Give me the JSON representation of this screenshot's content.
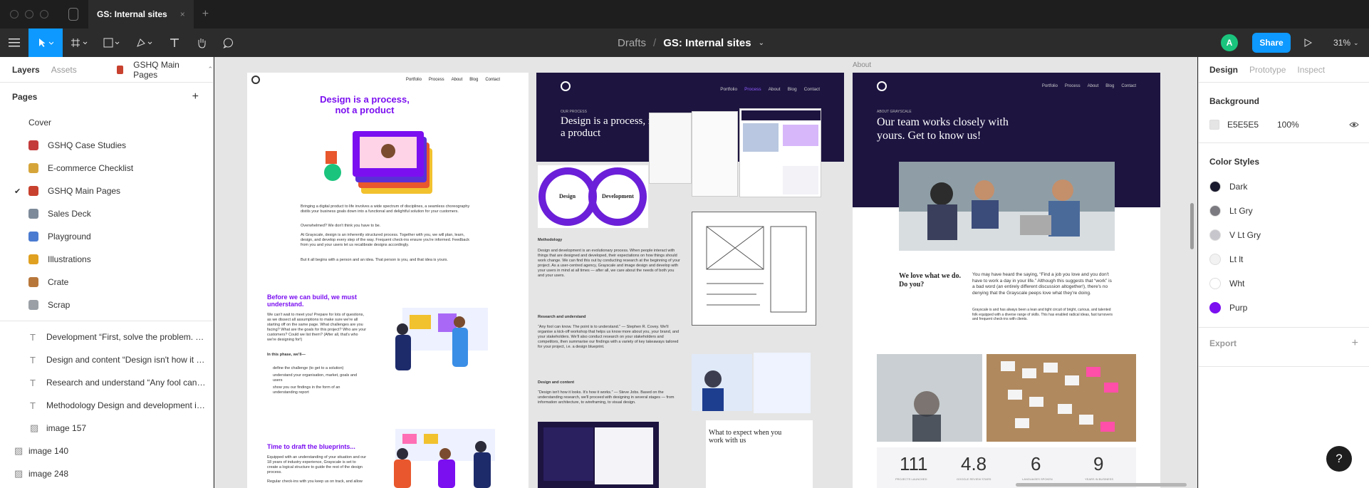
{
  "titlebar": {
    "tab_title": "GS: Internal sites",
    "tab_close": "×",
    "new_tab": "+"
  },
  "toolbar": {
    "breadcrumb_drafts": "Drafts",
    "breadcrumb_sep": "/",
    "breadcrumb_file": "GS: Internal sites",
    "avatar_initial": "A",
    "share_label": "Share",
    "zoom": "31%"
  },
  "left_panel": {
    "tabs": [
      "Layers",
      "Assets"
    ],
    "current_page": "GSHQ Main Pages",
    "pages_header": "Pages",
    "add": "+",
    "pages": [
      {
        "label": "Cover",
        "color": ""
      },
      {
        "label": "GSHQ Case Studies",
        "color": "#c43b3b"
      },
      {
        "label": "E-commerce Checklist",
        "color": "#d6a53a"
      },
      {
        "label": "GSHQ Main Pages",
        "color": "#c8412e",
        "checked": true
      },
      {
        "label": "Sales Deck",
        "color": "#7d8a99"
      },
      {
        "label": "Playground",
        "color": "#4a7bd0"
      },
      {
        "label": "Illustrations",
        "color": "#e0a020"
      },
      {
        "label": "Crate",
        "color": "#b8773a"
      },
      {
        "label": "Scrap",
        "color": "#9aa0a6"
      }
    ],
    "layers": [
      {
        "label": "Development “First, solve the problem. T...",
        "icon": "text-icon"
      },
      {
        "label": "Design and content “Design isn't how it lo...",
        "icon": "text-icon"
      },
      {
        "label": "Research and understand “Any fool can k...",
        "icon": "text-icon"
      },
      {
        "label": "Methodology Design and development is...",
        "icon": "text-icon"
      },
      {
        "label": "image 157",
        "icon": "image-icon"
      },
      {
        "label": "image 140",
        "icon": "image-icon"
      },
      {
        "label": "image 248",
        "icon": "image-icon"
      }
    ]
  },
  "canvas": {
    "frame_label": "About",
    "board1": {
      "nav": [
        "Portfolio",
        "Process",
        "About",
        "Blog",
        "Contact"
      ],
      "headline": "Design is a process, not a product",
      "intro": "Bringing a digital product to life involves a wide spectrum of disciplines, a seamless choreography distils your business goals down into a functional and delightful solution for your customers.",
      "intro2": "Overwhelmed? We don't think you have to be.",
      "intro3": "At Grayscale, design is an inherently structured process. Together with you, we will plan, learn, design, and develop every step of the way. Frequent check-ins ensure you're informed. Feedback from you and your users let us recalibrate designs accordingly.",
      "intro4": "But it all begins with a person and an idea. That person is you, and that idea is yours.",
      "h2": "Before we can build, we must understand.",
      "body2": "We can't wait to meet you! Prepare for lots of questions, as we dissect all assumptions to make sure we're all starting off on the same page. What challenges are you facing? What are the goals for this project? Who are your customers? Could we list them? (After all, that's who we're designing for!)",
      "phase": "In this phase, we'll—",
      "bullets": [
        "define the challenge (to get to a solution)",
        "understand your organisation, market, goals and users",
        "show you our findings in the form of an understanding report"
      ],
      "h3": "Time to draft the blueprints...",
      "body3": "Equipped with an understanding of your situation and our 18 years of industry experience, Grayscale is set to create a logical structure to guide the rest of the design process.",
      "body3b": "Regular check-ins with you keep us on track, and allow"
    },
    "board2": {
      "eyebrow": "OUR PROCESS",
      "headline": "Design is a process, not a product",
      "nav": [
        "Portfolio",
        "Process",
        "About",
        "Blog",
        "Contact"
      ],
      "ring1": "Design",
      "ring2": "Development",
      "methodology": "Methodology",
      "meth_body": "Design and development is an evolutionary process. When people interact with things that are designed and developed, their expectations on how things should work change. We can find this out by conducting research at the beginning of your project. As a user-centred agency, Grayscale and image design and develop with your users in mind at all times — after all, we care about the needs of both you and your users.",
      "research": "Research and understand",
      "research_body": "“Any fool can know. The point is to understand.” — Stephen R. Covey. We'll organise a kick-off workshop that helps us know more about you, your brand, and your stakeholders. We'll also conduct research on your stakeholders and competitors, then summarise our findings with a variety of key takeaways tailored for your project, i.e. a design blueprint.",
      "design": "Design and content",
      "design_body": "“Design isn't how it looks. It's how it works.” — Steve Jobs. Based on the understanding research, we'll proceed with designing in several stages — from information architecture, to wireframing, to visual design.",
      "expect": "What to expect when you work with us"
    },
    "board3": {
      "eyebrow": "ABOUT GRAYSCALE",
      "headline": "Our team works closely with yours. Get to know us!",
      "nav": [
        "Portfolio",
        "Process",
        "About",
        "Blog",
        "Contact"
      ],
      "love": "We love what we do. Do you?",
      "love_body": "You may have heard the saying, “Find a job you love and you don't have to work a day in your life.” Although this suggests that “work” is a bad word (an entirely different discussion altogether!), there's no denying that the Grayscale peeps love what they're doing.",
      "love_body2": "Grayscale is and has always been a lean and tight circuit of bright, curious, and talented folk equipped with a diverse range of skills. This has enabled radical ideas, fast turnovers and frequent check-ins with clients.",
      "stats": [
        {
          "value": "111",
          "label": "PROJECTS LAUNCHED"
        },
        {
          "value": "4.8",
          "label": "GOOGLE REVIEW STARS"
        },
        {
          "value": "6",
          "label": "LANGUAGES SPOKEN"
        },
        {
          "value": "9",
          "label": "YEARS IN BUSINESS"
        }
      ]
    }
  },
  "right_panel": {
    "tabs": [
      "Design",
      "Prototype",
      "Inspect"
    ],
    "background_header": "Background",
    "bg_hex": "E5E5E5",
    "bg_opacity": "100%",
    "color_styles_header": "Color Styles",
    "styles": [
      {
        "name": "Dark",
        "color": "#1a1a2e"
      },
      {
        "name": "Lt Gry",
        "color": "#7a7a80"
      },
      {
        "name": "V Lt Gry",
        "color": "#c6c6cc"
      },
      {
        "name": "Lt lt",
        "color": "#f2f2f2"
      },
      {
        "name": "Wht",
        "color": "#ffffff"
      },
      {
        "name": "Purp",
        "color": "#7b0ff0"
      }
    ],
    "export_header": "Export",
    "export_add": "+"
  },
  "help": "?"
}
